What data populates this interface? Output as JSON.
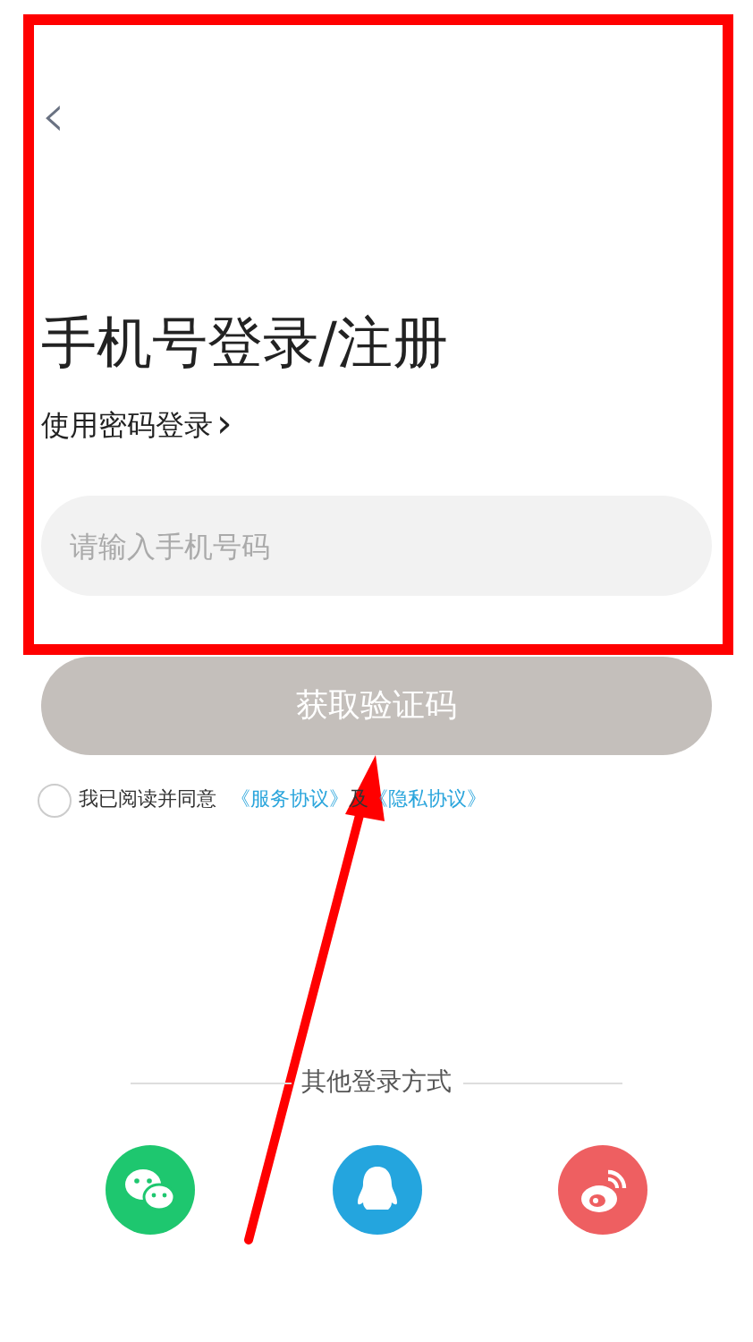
{
  "header": {
    "back": "‹"
  },
  "title": "手机号登录/注册",
  "password_login": {
    "label": "使用密码登录",
    "chevron": "›"
  },
  "phone_field": {
    "placeholder": "请输入手机号码"
  },
  "get_code_button": {
    "label": "获取验证码",
    "disabled": true
  },
  "agreement": {
    "checked": false,
    "text": "我已阅读并同意",
    "links": [
      "《服务协议》",
      "《隐私协议》"
    ],
    "joiner": "及"
  },
  "other_login": {
    "label": "其他登录方式",
    "options": [
      {
        "kind": "wechat",
        "color": "#1ec76f"
      },
      {
        "kind": "qq",
        "color": "#24a5de"
      },
      {
        "kind": "weibo",
        "color": "#ee5f61"
      }
    ]
  }
}
